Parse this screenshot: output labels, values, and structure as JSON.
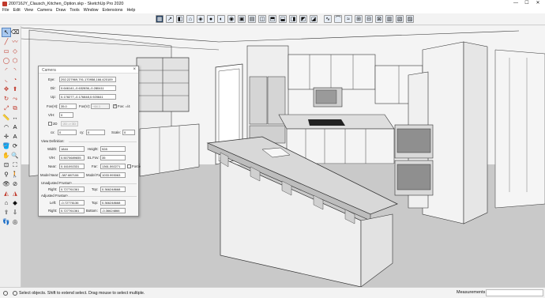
{
  "window": {
    "title": "200716JY_Clausch_Kitchen_Option.skp - SketchUp Pro 2020",
    "controls": [
      "—",
      "☐",
      "✕"
    ]
  },
  "menu": [
    "File",
    "Edit",
    "View",
    "Camera",
    "Draw",
    "Tools",
    "Window",
    "Extensions",
    "Help"
  ],
  "toolbar_icons": [
    "view-icon",
    "arrow-icon",
    "cube-icon",
    "house-icon",
    "layers-icon",
    "circle-icon",
    "circle-icon",
    "camera-icon",
    "grid-icon",
    "grid-icon",
    "cube-icon",
    "cube-icon",
    "cube-icon",
    "cube-icon",
    "cube-icon",
    "cube-icon",
    "curve-icon",
    "arc-icon",
    "wave-icon",
    "grid-icon",
    "grid-icon",
    "grid-icon",
    "grid-icon",
    "grid-icon",
    "grid-icon"
  ],
  "camera_dialog": {
    "title": "Camera",
    "close": "×",
    "eye_label": "Eye:",
    "eye_value": "292.227969,791.170958,166.420109",
    "dir_label": "Dir:",
    "dir_value": "0.646141,-0.632836,-0.280411",
    "up_label": "Up:",
    "up_value": "0.178277,-0.176848,0.920641",
    "fovh_label": "Fov(H):",
    "fovh_value": "35.0",
    "fovv_label": "Fov(V):",
    "fovv_value": "~64.1",
    "fov_eq_label": "Fov: =/4",
    "vh_label": "V/H:",
    "vh_value": "0",
    "cb_2d_label": "2D",
    "cb_2d_button": "2D -> 3D",
    "cx_label": "cx:",
    "cx_value": "0",
    "cy_label": "cy:",
    "cy_value": "0",
    "scale_label": "Scale:",
    "scale_value": "0",
    "view_def_label": "View Definition:",
    "width_label": "Width:",
    "width_value": "1844",
    "height_label": "Height:",
    "height_value": "928",
    "vh2_label": "V/H:",
    "vh2_value": "0.5070689655",
    "elfov_label": "EL Fov:",
    "elfov_value": "35",
    "near_label": "Near:",
    "near_value": "0.161092331",
    "far_label": "Far:",
    "far_value": "1361.592271",
    "model_near_label": "Model Near:",
    "model_near_value": "-387.887106",
    "model_far_label": "Model Far:",
    "model_far_value": "1033.993063",
    "force_label": "Force",
    "unadj_label": "Unadjusted Frustum",
    "u_right_label": "Right:",
    "u_right_value": "0.727761361",
    "u_top_label": "Top:",
    "u_top_value": "0.366248668",
    "adj_label": "Adjusted Frustum",
    "a_left_label": "Left:",
    "a_left_value": "-0.72776136",
    "a_top_label": "Top:",
    "a_top_value": "0.366248668",
    "a_right_label": "Right:",
    "a_right_value": "0.727761361",
    "a_bottom_label": "Bottom:",
    "a_bottom_value": "-0.36624866"
  },
  "status": {
    "text": "Select objects. Shift to extend select. Drag mouse to select multiple.",
    "measurements_label": "Measurements"
  }
}
